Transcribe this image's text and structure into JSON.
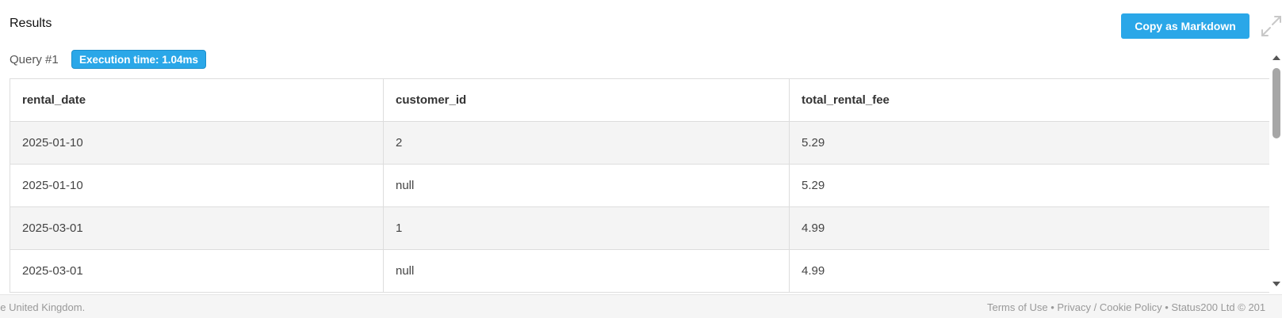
{
  "results": {
    "title": "Results",
    "copy_button_label": "Copy as Markdown",
    "expand_icon": "expand-arrows-icon"
  },
  "query": {
    "label": "Query #1",
    "execution_time": "Execution time: 1.04ms"
  },
  "table": {
    "columns": [
      "rental_date",
      "customer_id",
      "total_rental_fee"
    ],
    "rows": [
      [
        "2025-01-10",
        "2",
        "5.29"
      ],
      [
        "2025-01-10",
        "null",
        "5.29"
      ],
      [
        "2025-03-01",
        "1",
        "4.99"
      ],
      [
        "2025-03-01",
        "null",
        "4.99"
      ]
    ]
  },
  "footer": {
    "left_text": "he United Kingdom.",
    "terms": "Terms of Use",
    "privacy": "Privacy / Cookie Policy",
    "copyright": "Status200 Ltd © 201",
    "separator": "•"
  },
  "colors": {
    "accent": "#2aa7e8",
    "row_alt": "#f4f4f4",
    "footer_bg": "#f5f5f5"
  }
}
